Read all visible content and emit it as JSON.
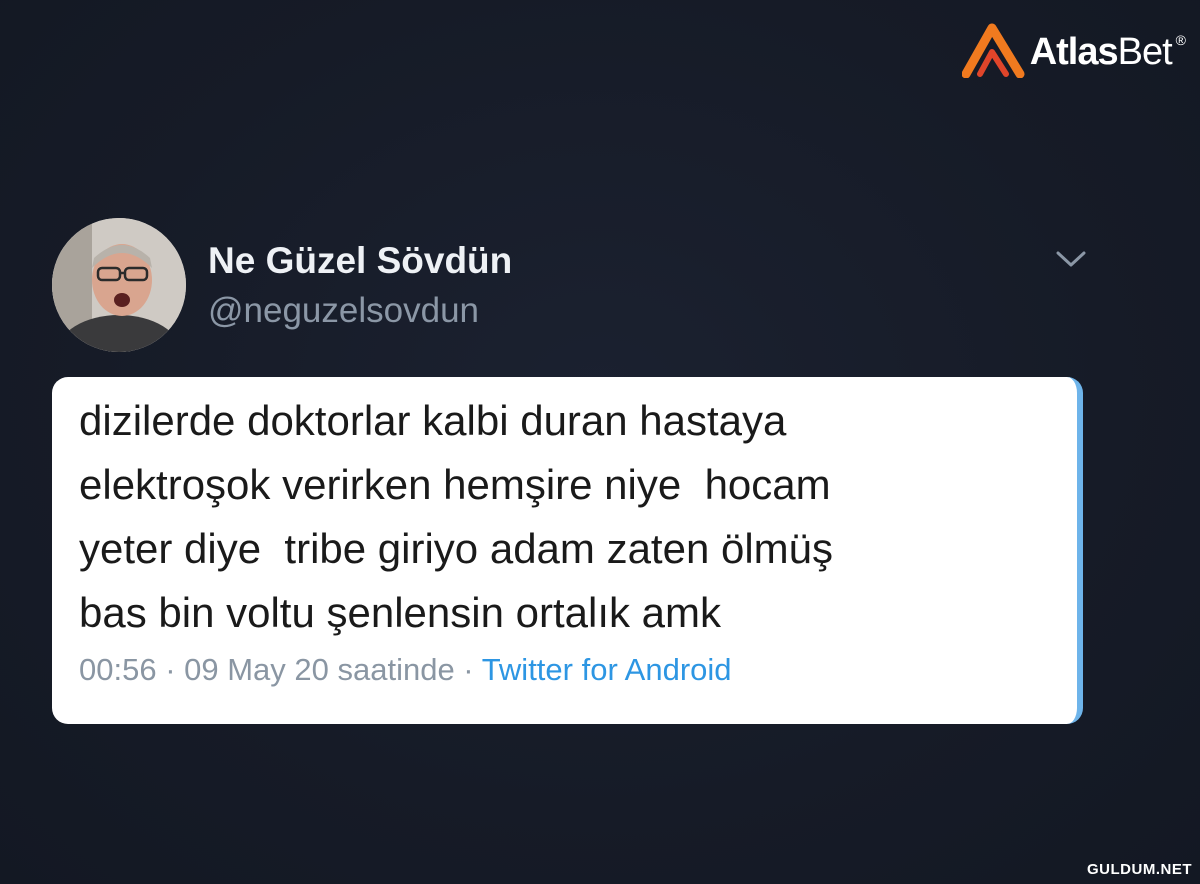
{
  "brand": {
    "name_bold": "Atlas",
    "name_light": "Bet",
    "registered": "®",
    "colors": {
      "mark_orange": "#f07a1f",
      "mark_red": "#e0452a"
    }
  },
  "tweet": {
    "display_name": "Ne Güzel Sövdün",
    "handle": "@neguzelsovdun",
    "menu_icon": "chevron-down-icon",
    "text": "dizilerde doktorlar kalbi duran hastaya\nelektroşok verirken hemşire niye  hocam\nyeter diye  tribe giriyo adam zaten ölmüş\nbas bin voltu şenlensin ortalık amk",
    "time_date": "00:56 · 09 May 20 saatinde · ",
    "source": "Twitter for Android",
    "colors": {
      "source_link": "#2d96e3",
      "accent_border": "#6eb4ea"
    }
  },
  "watermark": "GULDUM.NET"
}
